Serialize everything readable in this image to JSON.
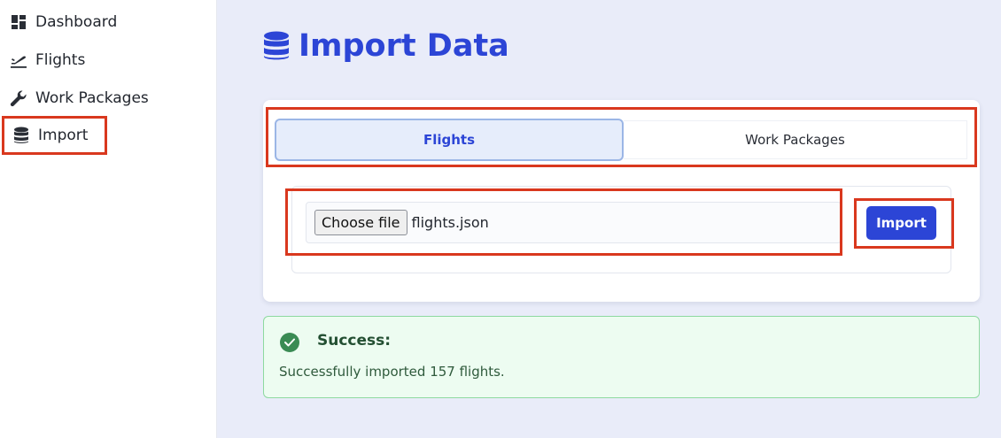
{
  "sidebar": {
    "items": [
      {
        "label": "Dashboard",
        "icon": "dashboard-icon"
      },
      {
        "label": "Flights",
        "icon": "plane-departure-icon"
      },
      {
        "label": "Work Packages",
        "icon": "wrench-icon"
      },
      {
        "label": "Import",
        "icon": "database-icon",
        "active": true
      }
    ]
  },
  "page": {
    "title": "Import Data",
    "title_icon": "database-icon"
  },
  "tabs": [
    {
      "label": "Flights",
      "selected": true
    },
    {
      "label": "Work Packages",
      "selected": false
    }
  ],
  "upload": {
    "choose_label": "Choose file",
    "file_name": "flights.json",
    "import_label": "Import"
  },
  "alert": {
    "type": "success",
    "title": "Success:",
    "message": "Successfully imported 157 flights."
  },
  "colors": {
    "accent": "#2c45d6",
    "highlight_outline": "#d9381e",
    "success_bg": "#edfcf1",
    "success_icon": "#3a8b54",
    "main_bg": "#e9ecf9"
  }
}
